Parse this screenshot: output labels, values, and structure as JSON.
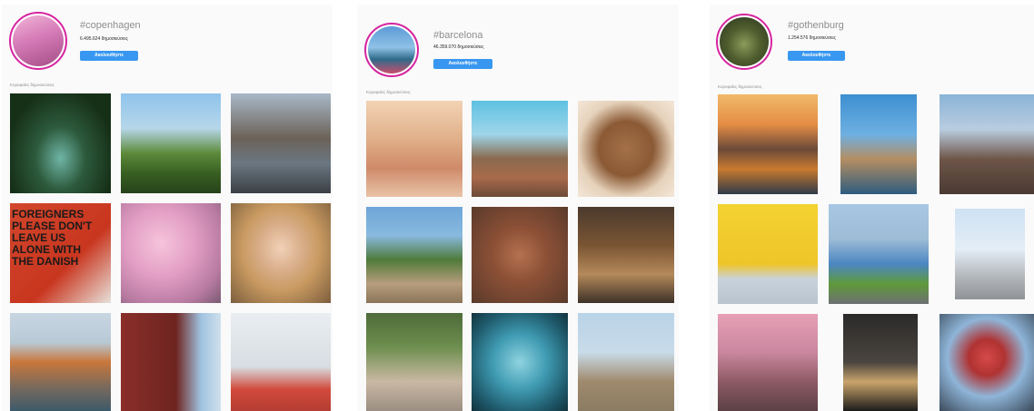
{
  "panels": [
    {
      "hashtag": "#copenhagen",
      "posts": "6.495.624 δημοσιεύσεις",
      "follow_label": "Ακολουθήστε",
      "section_label": "Κορυφαίες δημοσιεύσεις",
      "poster_text": "FOREIGNERS PLEASE DON'T LEAVE US ALONE WITH THE DANISH"
    },
    {
      "hashtag": "#barcelona",
      "posts": "46.359.070 δημοσιεύσεις",
      "follow_label": "Ακολουθήστε",
      "section_label": "Κορυφαίες δημοσιεύσεις"
    },
    {
      "hashtag": "#gothenburg",
      "posts": "1.254.576 δημοσιεύσεις",
      "follow_label": "Ακολουθήστε",
      "section_label": "Κορυφαίες δημοσιεύσεις"
    }
  ],
  "colors": {
    "follow_button": "#3897f0",
    "avatar_ring": "#d6249f",
    "panel_bg": "#fafafa"
  }
}
